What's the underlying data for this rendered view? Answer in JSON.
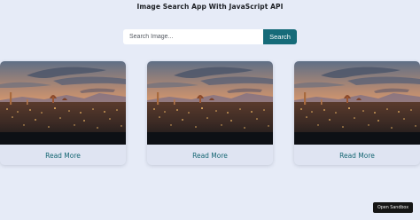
{
  "header": {
    "title": "Image Search App With JavaScript API"
  },
  "search": {
    "placeholder": "Search Image...",
    "button_label": "Search"
  },
  "cards": [
    {
      "link_label": "Read More"
    },
    {
      "link_label": "Read More"
    },
    {
      "link_label": "Read More"
    }
  ],
  "footer": {
    "sandbox_label": "Open Sandbox"
  },
  "colors": {
    "background": "#e6ebf7",
    "accent": "#166b79",
    "link": "#156673",
    "sandbox_button": "#151515"
  }
}
